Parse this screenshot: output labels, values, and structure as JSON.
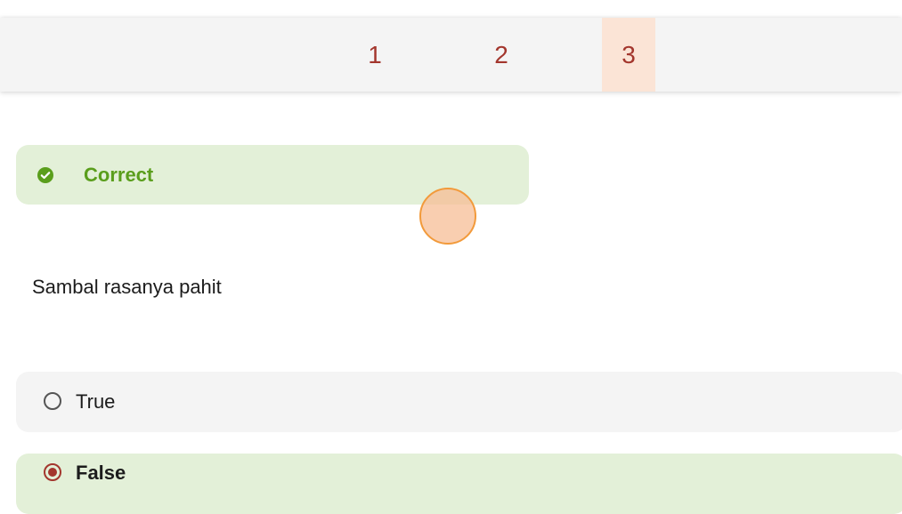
{
  "pagination": {
    "pages": [
      "1",
      "2",
      "3"
    ],
    "active_page": "3",
    "accent_color": "#a3362d",
    "active_bg": "#fbe4d6"
  },
  "feedback": {
    "icon": "check-circle-icon",
    "label": "Correct",
    "color": "#5a9e1c",
    "bg": "#e3f0d8"
  },
  "question": {
    "text": "Sambal rasanya pahit"
  },
  "options": [
    {
      "label": "True",
      "selected": false
    },
    {
      "label": "False",
      "selected": true
    }
  ]
}
